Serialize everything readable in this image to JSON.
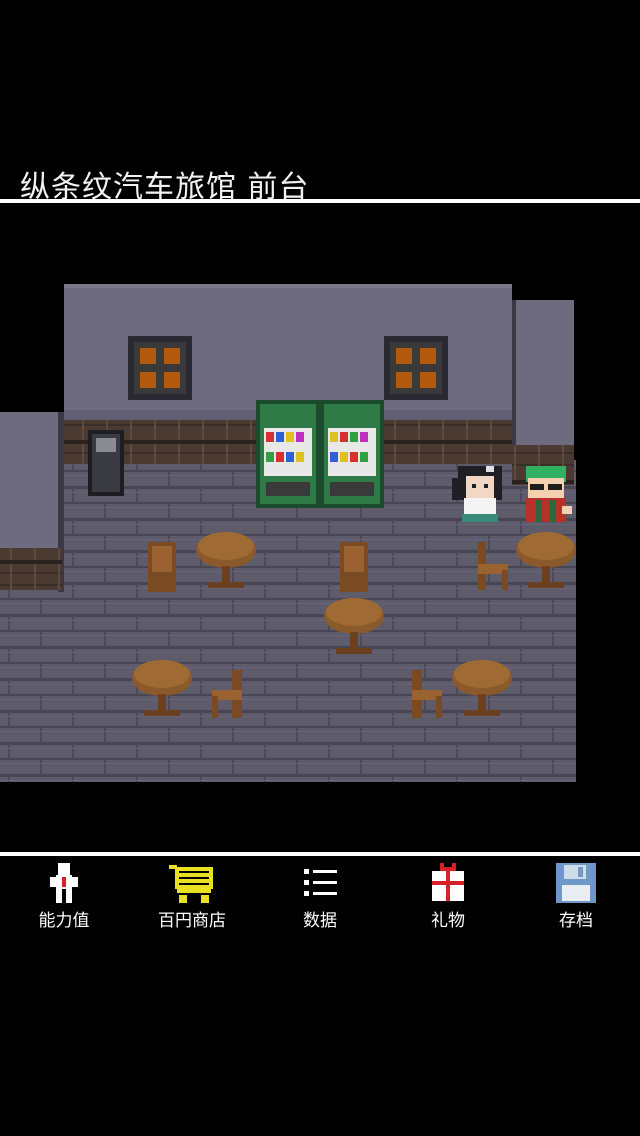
{
  "location": {
    "title": "纵条纹汽车旅馆 前台"
  },
  "toolbar": {
    "items": [
      {
        "label": "能力值",
        "icon": "person-icon"
      },
      {
        "label": "百円商店",
        "icon": "shopping-cart-icon"
      },
      {
        "label": "数据",
        "icon": "list-icon"
      },
      {
        "label": "礼物",
        "icon": "gift-icon"
      },
      {
        "label": "存档",
        "icon": "floppy-disk-icon"
      }
    ]
  },
  "colors": {
    "background": "#000000",
    "wall": "#6f6b7e",
    "floor": "#5a5866",
    "wood": "#8a5a2b",
    "vending": "#2f7a47",
    "cart": "#e8e020",
    "gift_red": "#d8202a",
    "floppy": "#6f98c8"
  }
}
